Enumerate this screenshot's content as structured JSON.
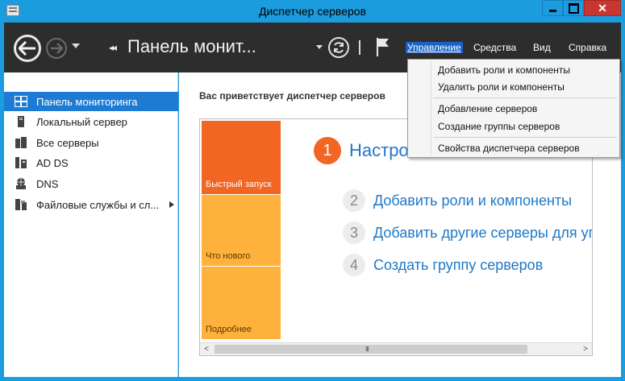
{
  "window": {
    "title": "Диспетчер серверов",
    "close_glyph": "✕"
  },
  "toolbar": {
    "breadcrumb_arrows": "◂◂",
    "page_title": "Панель монит...",
    "menus": [
      "Управление",
      "Средства",
      "Вид",
      "Справка"
    ]
  },
  "sidebar": {
    "items": [
      {
        "label": "Панель мониторинга",
        "icon": "dashboard-icon",
        "selected": true
      },
      {
        "label": "Локальный сервер",
        "icon": "server-icon"
      },
      {
        "label": "Все серверы",
        "icon": "servers-icon"
      },
      {
        "label": "AD DS",
        "icon": "ad-ds-icon"
      },
      {
        "label": "DNS",
        "icon": "dns-icon"
      },
      {
        "label": "Файловые службы и сл...",
        "icon": "file-services-icon"
      }
    ]
  },
  "main": {
    "welcome": "Вас приветствует диспетчер серверов",
    "tiles": [
      "Быстрый запуск",
      "Что нового",
      "Подробнее"
    ],
    "steps": [
      {
        "num": "1",
        "label": "Настроить этот локальный сервер"
      },
      {
        "num": "2",
        "label": "Добавить роли и компоненты"
      },
      {
        "num": "3",
        "label": "Добавить другие серверы для управления"
      },
      {
        "num": "4",
        "label": "Создать группу серверов"
      }
    ],
    "scroll_left": "<",
    "scroll_right": ">",
    "scroll_grip": "III"
  },
  "dropdown": {
    "items": [
      "Добавить роли и компоненты",
      "Удалить роли и компоненты",
      "Добавление серверов",
      "Создание группы серверов",
      "Свойства диспетчера серверов"
    ]
  },
  "colors": {
    "titlebar": "#1b9cdf",
    "toolbar": "#2d2d2d",
    "accent_orange": "#f26522",
    "tile_yellow": "#ffb13d",
    "link_blue": "#1f79c8",
    "selected_blue": "#1e7bd3"
  }
}
